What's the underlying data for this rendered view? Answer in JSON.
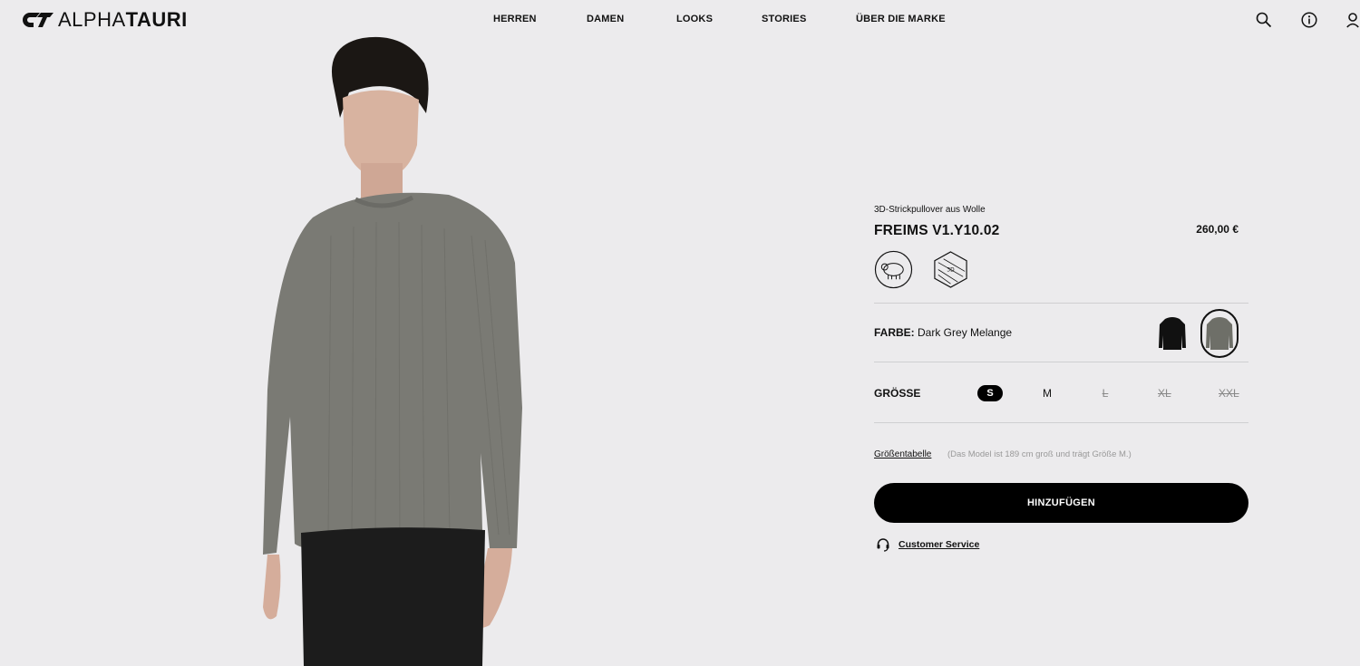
{
  "header": {
    "logo": {
      "light": "ALPHA",
      "bold": "TAURI"
    },
    "nav": [
      "HERREN",
      "DAMEN",
      "LOOKS",
      "STORIES",
      "ÜBER DIE MARKE"
    ],
    "icons": [
      "search-icon",
      "info-icon",
      "user-icon"
    ]
  },
  "product": {
    "subtitle": "3D-Strickpullover aus Wolle",
    "name": "FREIMS V1.Y10.02",
    "price": "260,00 €",
    "badges": [
      "wool-sheep-badge",
      "3d-knit-badge"
    ],
    "color": {
      "label": "FARBE:",
      "value": "Dark Grey Melange",
      "swatches": [
        "#111111",
        "#6e6f68"
      ],
      "selected_index": 1
    },
    "size": {
      "label": "GRÖSSE",
      "options": [
        "S",
        "M",
        "L",
        "XL",
        "XXL"
      ],
      "selected": "S",
      "unavailable": [
        "L",
        "XL",
        "XXL"
      ]
    },
    "size_table_link": "Größentabelle",
    "size_note": "(Das Model ist 189 cm groß und trägt Größe M.)",
    "add_button": "HINZUFÜGEN",
    "customer_service": "Customer Service"
  }
}
